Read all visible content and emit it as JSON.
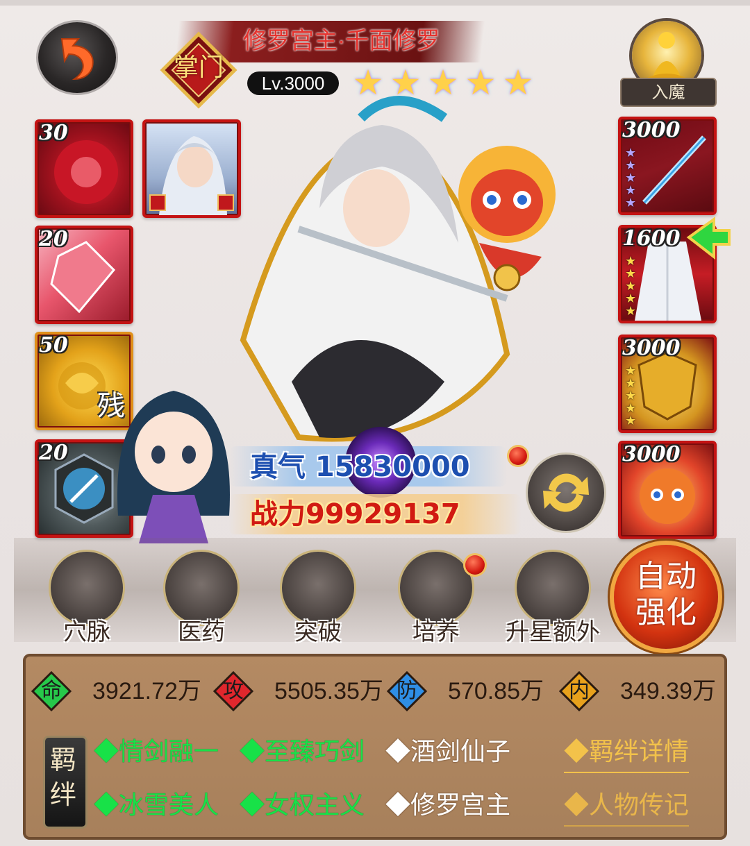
{
  "hero": {
    "title": "修罗宫主·千面修罗",
    "sect": "掌门",
    "level": "Lv.3000",
    "stars": 5
  },
  "rumo": {
    "label": "入魔"
  },
  "left_items": [
    {
      "level": "30",
      "icon": "red-flower-orb-icon"
    },
    {
      "level": "20",
      "icon": "pink-gem-icon"
    },
    {
      "level": "50",
      "icon": "golden-rose-fragment-icon",
      "tag": "残"
    },
    {
      "level": "20",
      "icon": "sword-compass-icon"
    }
  ],
  "partner": {
    "icon": "white-haired-partner-portrait"
  },
  "right_items": [
    {
      "level": "3000",
      "icon": "blue-sword-icon",
      "star_count": 5,
      "star_color": "#b6a6ff"
    },
    {
      "level": "1600",
      "icon": "white-robe-icon",
      "star_count": 5,
      "star_color": "#ffd94a",
      "upgrade_arrow": true
    },
    {
      "level": "3000",
      "icon": "golden-shield-icon",
      "star_count": 5,
      "star_color": "#ffd94a"
    },
    {
      "level": "3000",
      "icon": "dragon-pet-icon"
    }
  ],
  "stats": {
    "zhenqi": "真气 15830000",
    "zhanli": "战力99929137"
  },
  "functions": [
    {
      "label": "穴脉",
      "icon": "meridian-figure-icon"
    },
    {
      "label": "医药",
      "icon": "herb-medicine-icon"
    },
    {
      "label": "突破",
      "icon": "breakthrough-scholar-icon"
    },
    {
      "label": "培养",
      "icon": "training-scroll-icon"
    },
    {
      "label": "升星额外",
      "icon": "star-up-armor-icon"
    }
  ],
  "auto": {
    "label": "自动强化"
  },
  "attributes": [
    {
      "label": "命",
      "value": "3921.72万",
      "color": "#27c84a"
    },
    {
      "label": "攻",
      "value": "5505.35万",
      "color": "#e0272d"
    },
    {
      "label": "防",
      "value": "570.85万",
      "color": "#2f8ee5"
    },
    {
      "label": "内",
      "value": "349.39万",
      "color": "#e8a11c"
    }
  ],
  "bonds": {
    "tag": "羁绊",
    "row1": [
      "◆情剑融一",
      "◆至臻巧剑",
      "◆酒剑仙子"
    ],
    "row2": [
      "◆冰雪美人",
      "◆女权主义",
      "◆修罗宫主"
    ],
    "detail_link": "◆羁绊详情",
    "bio_link": "◆人物传记"
  }
}
